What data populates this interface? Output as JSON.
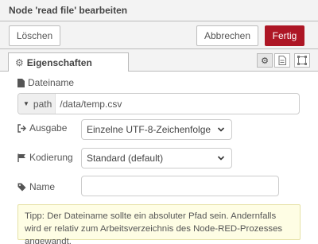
{
  "header": {
    "title": "Node 'read file' bearbeiten"
  },
  "toolbar": {
    "delete_label": "Löschen",
    "cancel_label": "Abbrechen",
    "done_label": "Fertig"
  },
  "tabs": [
    {
      "label": "Eigenschaften",
      "icon": "gear-icon"
    }
  ],
  "tab_icons": [
    "gear-icon",
    "document-icon",
    "frame-icon"
  ],
  "form": {
    "filename": {
      "label": "Dateiname",
      "type": "path",
      "value": "/data/temp.csv"
    },
    "output": {
      "label": "Ausgabe",
      "selected": "Einzelne UTF-8-Zeichenfolge"
    },
    "encoding": {
      "label": "Kodierung",
      "selected": "Standard (default)"
    },
    "name": {
      "label": "Name",
      "value": ""
    },
    "tip": "Tipp: Der Dateiname sollte ein absoluter Pfad sein. Andernfalls wird er relativ zum Arbeitsverzeichnis des Node-RED-Prozesses angewandt."
  },
  "colors": {
    "accent": "#ad1625",
    "tip_bg": "#fefde4",
    "header_bg": "#f3f3f3"
  }
}
